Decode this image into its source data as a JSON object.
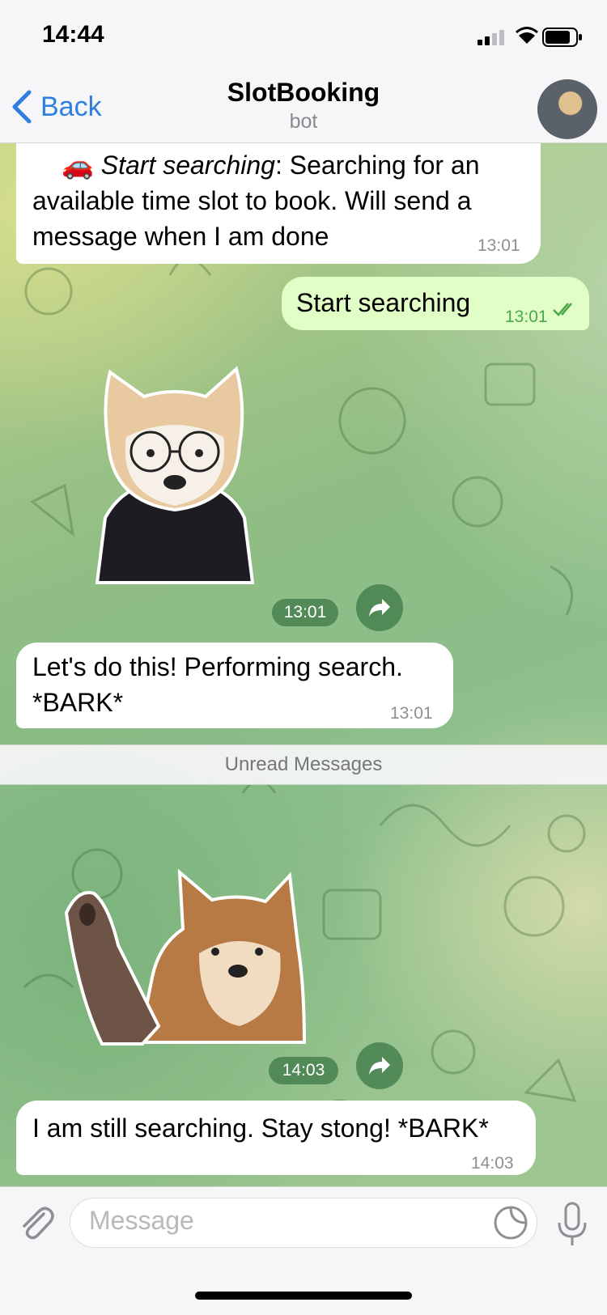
{
  "status_bar": {
    "time": "14:44"
  },
  "header": {
    "back_label": "Back",
    "title": "SlotBooking",
    "subtitle": "bot"
  },
  "messages": {
    "m1": {
      "emoji": "🚗",
      "italic": "Start searching",
      "text_line1": ": Searching for an",
      "text_line2": "available time slot to book. Will send a",
      "text_line3": "message when I am done",
      "time": "13:01"
    },
    "m2": {
      "text": "Start searching",
      "time": "13:01"
    },
    "sticker1": {
      "time": "13:01"
    },
    "m3": {
      "text_line1": "Let's do this! Performing search.",
      "text_line2": "*BARK*",
      "time": "13:01"
    },
    "unread": "Unread Messages",
    "sticker2": {
      "time": "14:03"
    },
    "m4": {
      "text": "I am still searching. Stay stong! *BARK*",
      "time": "14:03"
    }
  },
  "input": {
    "placeholder": "Message"
  },
  "colors": {
    "accent": "#2f7fe0",
    "outgoing_bubble": "#e1fec6",
    "outgoing_time": "#4aa848"
  }
}
